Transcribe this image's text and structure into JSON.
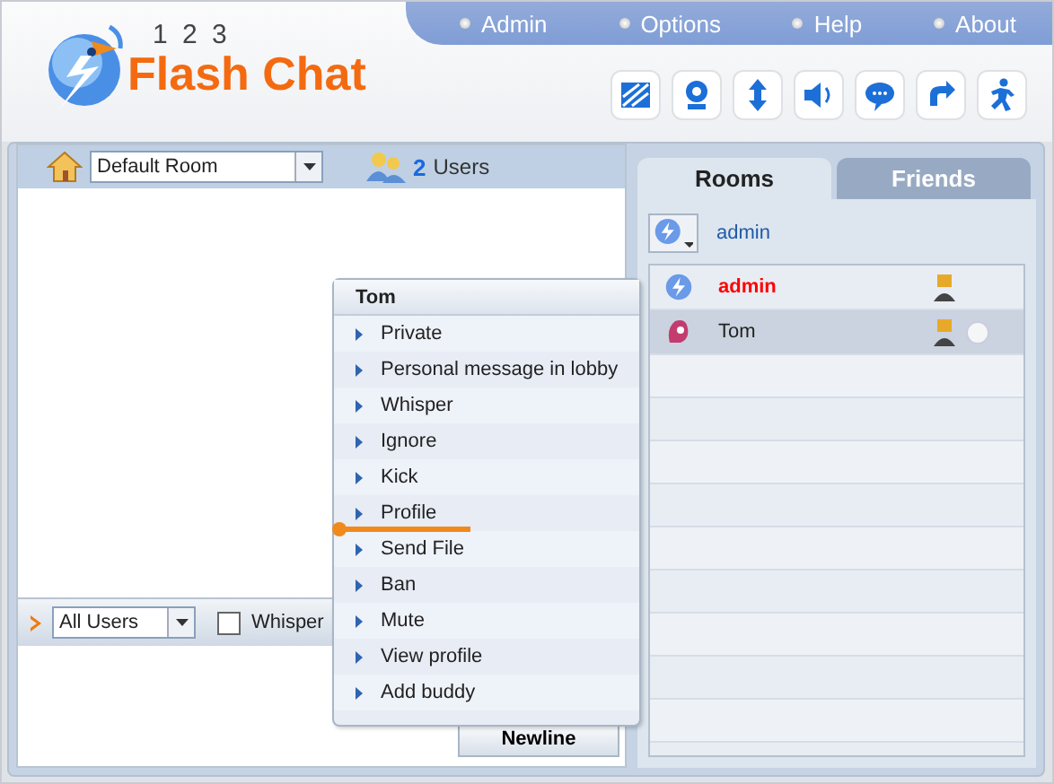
{
  "header": {
    "logo_small": "1 2 3",
    "logo": "Flash Chat",
    "nav": [
      "Admin",
      "Options",
      "Help",
      "About"
    ]
  },
  "room_bar": {
    "room": "Default Room",
    "user_count": "2",
    "user_label": "Users"
  },
  "input_bar": {
    "recipient": "All Users",
    "whisper": {
      "label": "Whisper",
      "checked": false
    },
    "newline_button": "Newline"
  },
  "tabs": [
    {
      "label": "Rooms",
      "selected": true
    },
    {
      "label": "Friends",
      "selected": false
    }
  ],
  "current_user": "admin",
  "users": [
    {
      "name": "admin",
      "kind": "admin",
      "selected": false
    },
    {
      "name": "Tom",
      "kind": "user",
      "selected": true
    }
  ],
  "context_menu": {
    "title": "Tom",
    "items": [
      "Private",
      "Personal message in lobby",
      "Whisper",
      "Ignore",
      "Kick",
      "Profile",
      "Send File",
      "Ban",
      "Mute",
      "View profile",
      "Add buddy"
    ]
  }
}
